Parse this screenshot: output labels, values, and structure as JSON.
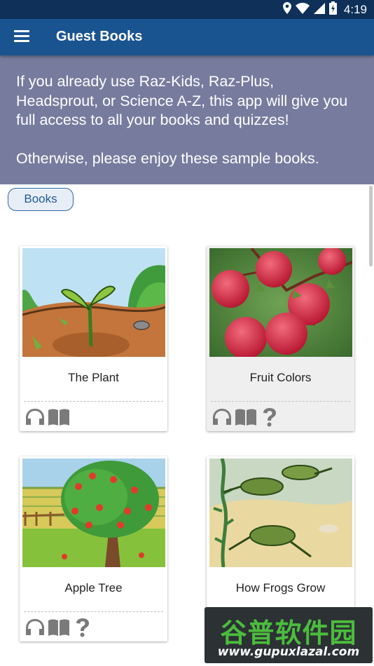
{
  "status_bar": {
    "time": "4:19",
    "icons": [
      "location-icon",
      "wifi-icon",
      "signal-icon",
      "battery-icon"
    ]
  },
  "app_bar": {
    "title": "Guest Books",
    "menu_icon": "menu-icon"
  },
  "banner": {
    "line1": "If you already use Raz-Kids, Raz-Plus, Headsprout, or Science A-Z, this app will give you full access to all your books and quizzes!",
    "line2": "Otherwise, please enjoy these sample books."
  },
  "filter": {
    "books_label": "Books"
  },
  "books": [
    {
      "title": "The Plant",
      "icons": [
        "headphones-icon",
        "book-icon"
      ]
    },
    {
      "title": "Fruit Colors",
      "icons": [
        "headphones-icon",
        "book-icon",
        "quiz-icon"
      ]
    },
    {
      "title": "Apple Tree",
      "icons": [
        "headphones-icon",
        "book-icon",
        "quiz-icon"
      ]
    },
    {
      "title": "How Frogs Grow",
      "icons": []
    }
  ],
  "watermark": {
    "chinese": "谷普软件园",
    "url": "www.gupuxlazal.com"
  },
  "colors": {
    "status_bar": "#0e3059",
    "app_bar": "#1a5490",
    "banner": "#777c9e",
    "icon_gray": "#7a7a7a"
  }
}
